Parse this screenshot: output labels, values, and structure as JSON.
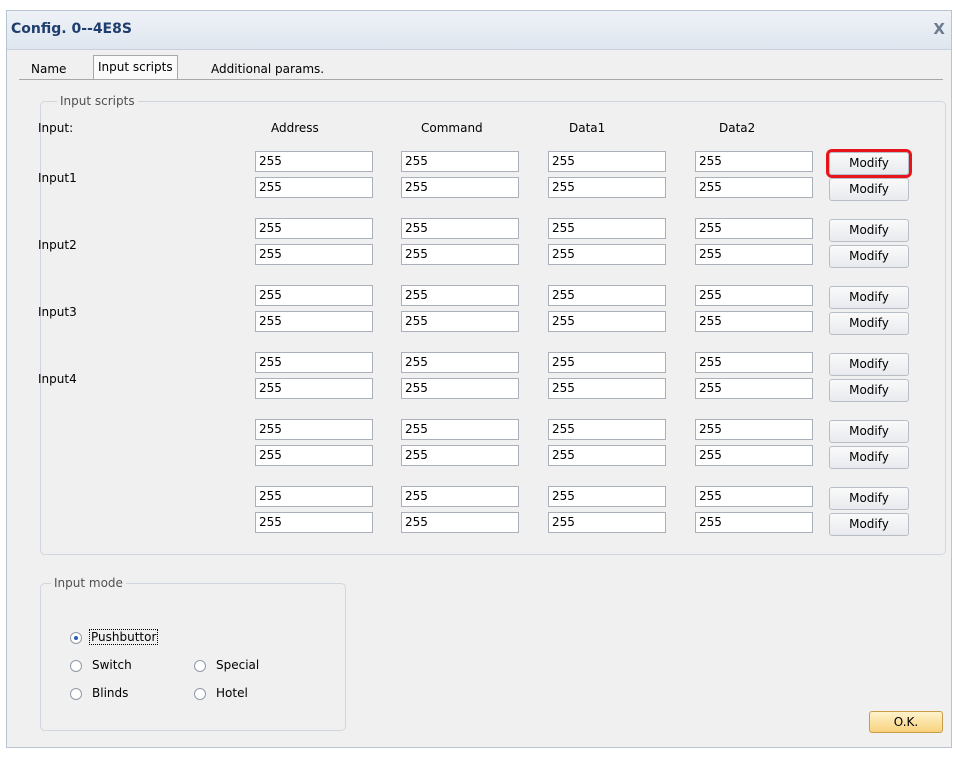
{
  "window": {
    "title": "Config. 0--4E8S",
    "close_glyph": "X"
  },
  "tabs": [
    {
      "label": "Name",
      "active": false
    },
    {
      "label": "Input scripts",
      "active": true
    },
    {
      "label": "Additional params.",
      "active": false
    }
  ],
  "scripts_group": {
    "legend": "Input scripts",
    "headers": {
      "input": "Input:",
      "address": "Address",
      "command": "Command",
      "data1": "Data1",
      "data2": "Data2"
    },
    "row_groups": [
      {
        "label": "Input1",
        "rows": [
          {
            "address": "255",
            "command": "255",
            "data1": "255",
            "data2": "255",
            "button": "Modify"
          },
          {
            "address": "255",
            "command": "255",
            "data1": "255",
            "data2": "255",
            "button": "Modify"
          }
        ]
      },
      {
        "label": "Input2",
        "rows": [
          {
            "address": "255",
            "command": "255",
            "data1": "255",
            "data2": "255",
            "button": "Modify"
          },
          {
            "address": "255",
            "command": "255",
            "data1": "255",
            "data2": "255",
            "button": "Modify"
          }
        ]
      },
      {
        "label": "Input3",
        "rows": [
          {
            "address": "255",
            "command": "255",
            "data1": "255",
            "data2": "255",
            "button": "Modify"
          },
          {
            "address": "255",
            "command": "255",
            "data1": "255",
            "data2": "255",
            "button": "Modify"
          }
        ]
      },
      {
        "label": "Input4",
        "rows": [
          {
            "address": "255",
            "command": "255",
            "data1": "255",
            "data2": "255",
            "button": "Modify"
          },
          {
            "address": "255",
            "command": "255",
            "data1": "255",
            "data2": "255",
            "button": "Modify"
          }
        ]
      },
      {
        "label": "",
        "rows": [
          {
            "address": "255",
            "command": "255",
            "data1": "255",
            "data2": "255",
            "button": "Modify"
          },
          {
            "address": "255",
            "command": "255",
            "data1": "255",
            "data2": "255",
            "button": "Modify"
          }
        ]
      },
      {
        "label": "",
        "rows": [
          {
            "address": "255",
            "command": "255",
            "data1": "255",
            "data2": "255",
            "button": "Modify"
          },
          {
            "address": "255",
            "command": "255",
            "data1": "255",
            "data2": "255",
            "button": "Modify"
          }
        ]
      }
    ]
  },
  "input_mode": {
    "legend": "Input mode",
    "options": [
      {
        "label": "Pushbuttor",
        "selected": true
      },
      {
        "label": "Switch",
        "selected": false
      },
      {
        "label": "Special",
        "selected": false
      },
      {
        "label": "Blinds",
        "selected": false
      },
      {
        "label": "Hotel",
        "selected": false
      }
    ]
  },
  "ok_button": "O.K.",
  "colors": {
    "highlight": "#e8141c",
    "title_text": "#1f3d6d",
    "ok_button": "#f7d27c"
  }
}
